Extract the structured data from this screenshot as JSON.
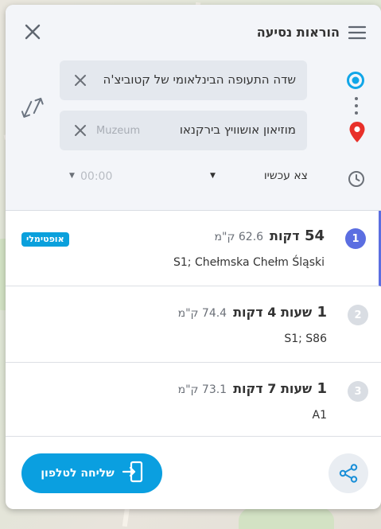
{
  "header": {
    "title": "הוראות נסיעה",
    "menu_icon": "menu-icon",
    "close_icon": "close-icon"
  },
  "origin": {
    "value": "שדה התעופה הבינלאומי של קטוביצ'ה",
    "icon": "origin-circle-icon"
  },
  "destination": {
    "value": "מוזיאון אושוויץ בירקנאו",
    "ghost_text": "Muzeum Auschwitz Oświęcimia",
    "icon": "destination-pin-icon"
  },
  "departure": {
    "mode_label": "צא עכשיו",
    "time_placeholder": "00:00",
    "clock_icon": "clock-icon"
  },
  "routes": [
    {
      "index": "1",
      "duration_num": "54",
      "duration_unit": "דקות",
      "distance": "62.6",
      "distance_unit": "ק\"מ",
      "via": "S1; Chełmska Chełm Śląski",
      "tag": "אופטימלי",
      "selected": true
    },
    {
      "index": "2",
      "duration_num": "1",
      "duration_unit": "שעות 4 דקות",
      "distance": "74.4",
      "distance_unit": "ק\"מ",
      "via": "S1; S86",
      "selected": false
    },
    {
      "index": "3",
      "duration_num": "1",
      "duration_unit": "שעות 7 דקות",
      "distance": "73.1",
      "distance_unit": "ק\"מ",
      "via": "A1",
      "selected": false
    }
  ],
  "footer": {
    "send_label": "שליחה לטלפון",
    "share_icon": "share-icon"
  },
  "colors": {
    "accent": "#0a9fe0",
    "selected_badge": "#5b6ee1",
    "inactive_badge": "#d9dde3",
    "origin": "#11a6e8",
    "destination": "#e8302a"
  }
}
